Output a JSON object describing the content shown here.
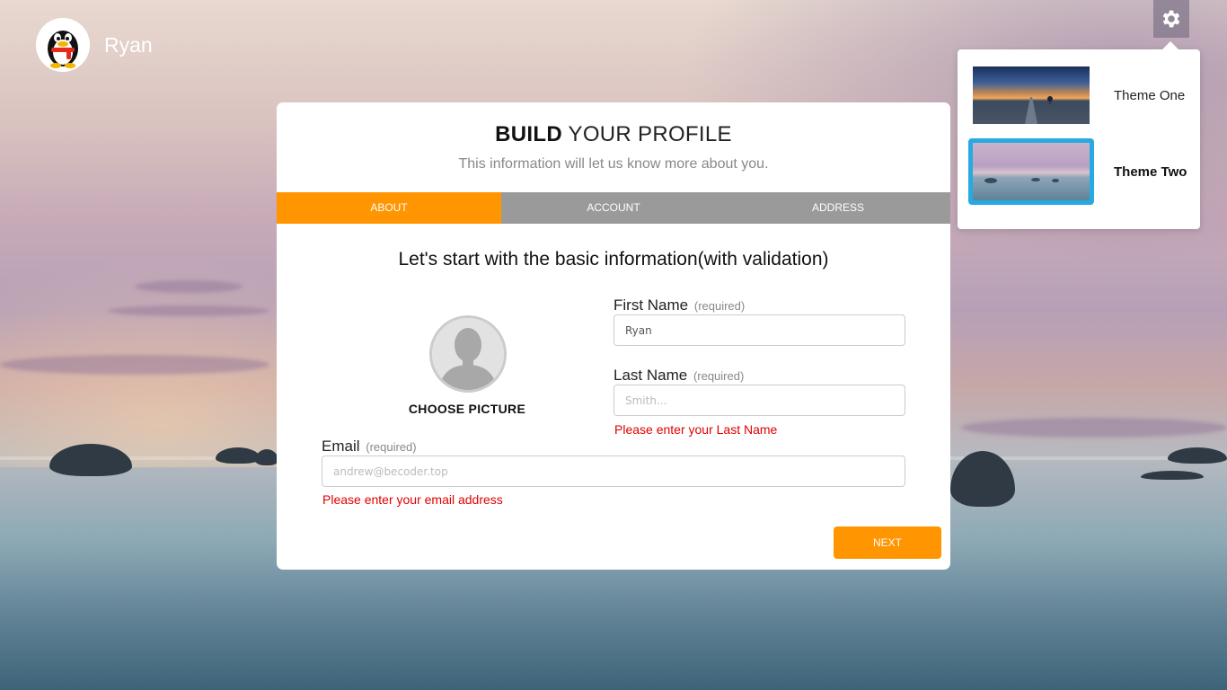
{
  "header": {
    "username": "Ryan"
  },
  "settings": {
    "themes": [
      {
        "label": "Theme One",
        "selected": false
      },
      {
        "label": "Theme Two",
        "selected": true
      }
    ]
  },
  "card": {
    "title_bold": "BUILD",
    "title_rest": " YOUR PROFILE",
    "subtitle": "This information will let us know more about you.",
    "tabs": [
      {
        "label": "About",
        "active": true
      },
      {
        "label": "Account",
        "active": false
      },
      {
        "label": "Address",
        "active": false
      }
    ],
    "section_title": "Let's start with the basic information(with validation)",
    "choose_picture": "CHOOSE PICTURE",
    "first_name": {
      "label": "First Name",
      "hint": "(required)",
      "value": "Ryan",
      "placeholder": ""
    },
    "last_name": {
      "label": "Last Name",
      "hint": "(required)",
      "value": "",
      "placeholder": "Smith...",
      "error": "Please enter your Last Name"
    },
    "email": {
      "label": "Email",
      "hint": "(required)",
      "value": "",
      "placeholder": "andrew@becoder.top",
      "error": "Please enter your email address"
    },
    "next_label": "Next"
  },
  "colors": {
    "accent": "#ff9500",
    "tab_bar": "#9a9a9a",
    "error": "#e00000",
    "selected_theme_border": "#27aae1"
  }
}
